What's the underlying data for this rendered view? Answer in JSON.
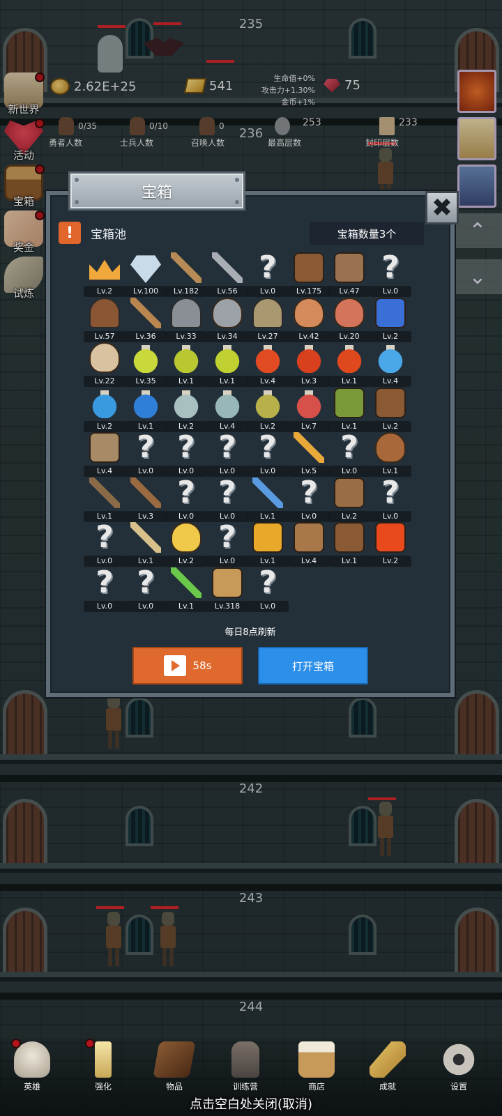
{
  "floors": [
    "235",
    "236",
    "242",
    "243",
    "244"
  ],
  "hud": {
    "gold": "2.62E+25",
    "bars": "541",
    "gems": "75",
    "bonus_hp": "生命值+0%",
    "bonus_atk": "攻击力+1.30%",
    "bonus_gold": "金币+1%"
  },
  "stats": [
    {
      "value": "0/35",
      "label": "勇者人数"
    },
    {
      "value": "0/10",
      "label": "士兵人数"
    },
    {
      "value": "0",
      "label": "召唤人数"
    },
    {
      "value": "253",
      "label": "最高层数"
    },
    {
      "value": "233",
      "label": "封印层数"
    }
  ],
  "side_menu": [
    {
      "label": "新世界",
      "icon": "scroll-map-icon"
    },
    {
      "label": "活动",
      "icon": "heart-icon"
    },
    {
      "label": "宝箱",
      "icon": "treasure-chest-icon"
    },
    {
      "label": "奖金",
      "icon": "envelope-icon"
    },
    {
      "label": "试炼",
      "icon": "feather-icon"
    }
  ],
  "modal": {
    "title": "宝箱",
    "pool_label": "宝箱池",
    "chest_count": "宝箱数量3个",
    "refresh_note": "每日8点刷新",
    "video_button": "58s",
    "open_button": "打开宝箱",
    "close_glyph": "✖",
    "alert_glyph": "!"
  },
  "items": [
    {
      "name": "crown-icon",
      "lv": "Lv.2",
      "color": "#f0a83a"
    },
    {
      "name": "diamond-icon",
      "lv": "Lv.100",
      "color": "#c9dbe8"
    },
    {
      "name": "bronze-sword-icon",
      "lv": "Lv.182",
      "color": "#b88a55"
    },
    {
      "name": "iron-sword-icon",
      "lv": "Lv.56",
      "color": "#a9aeb4"
    },
    {
      "name": "unknown-icon",
      "lv": "Lv.0",
      "color": ""
    },
    {
      "name": "leather-armor-icon",
      "lv": "Lv.175",
      "color": "#8a5a34"
    },
    {
      "name": "backpack-icon",
      "lv": "Lv.47",
      "color": "#9a7250"
    },
    {
      "name": "unknown-icon",
      "lv": "Lv.0",
      "color": ""
    },
    {
      "name": "leather-helmet-icon",
      "lv": "Lv.57",
      "color": "#8a5634"
    },
    {
      "name": "dagger-icon",
      "lv": "Lv.36",
      "color": "#b8864e"
    },
    {
      "name": "knight-helmet-icon",
      "lv": "Lv.33",
      "color": "#8a8f96"
    },
    {
      "name": "hammer-icon",
      "lv": "Lv.34",
      "color": "#9ca2a8"
    },
    {
      "name": "great-helm-icon",
      "lv": "Lv.27",
      "color": "#a99870"
    },
    {
      "name": "ham-icon",
      "lv": "Lv.42",
      "color": "#d48a5a"
    },
    {
      "name": "steak-icon",
      "lv": "Lv.20",
      "color": "#d4745a"
    },
    {
      "name": "blue-pouch-icon",
      "lv": "Lv.2",
      "color": "#3a6fd8"
    },
    {
      "name": "bread-icon",
      "lv": "Lv.22",
      "color": "#d9c2a0"
    },
    {
      "name": "yellow-potion-icon",
      "lv": "Lv.35",
      "color": "#c9d83a"
    },
    {
      "name": "yellow-potion-icon",
      "lv": "Lv.1",
      "color": "#b9c830"
    },
    {
      "name": "yellow-potion-icon",
      "lv": "Lv.1",
      "color": "#bfd030"
    },
    {
      "name": "red-potion-icon",
      "lv": "Lv.4",
      "color": "#e24a22"
    },
    {
      "name": "red-potion-icon",
      "lv": "Lv.3",
      "color": "#d8401e"
    },
    {
      "name": "red-potion-icon",
      "lv": "Lv.1",
      "color": "#e0481e"
    },
    {
      "name": "blue-potion-icon",
      "lv": "Lv.4",
      "color": "#4aa8e8"
    },
    {
      "name": "blue-potion-icon",
      "lv": "Lv.2",
      "color": "#3a9ae0"
    },
    {
      "name": "blue-potion-icon",
      "lv": "Lv.1",
      "color": "#2f7ed8"
    },
    {
      "name": "empty-flask-icon",
      "lv": "Lv.2",
      "color": "#a8c0c0"
    },
    {
      "name": "empty-flask-icon",
      "lv": "Lv.4",
      "color": "#98b8b8"
    },
    {
      "name": "wine-bottle-icon",
      "lv": "Lv.2",
      "color": "#b8b04a"
    },
    {
      "name": "red-vial-icon",
      "lv": "Lv.7",
      "color": "#d8504a"
    },
    {
      "name": "winged-boot-icon",
      "lv": "Lv.1",
      "color": "#7a9a3a"
    },
    {
      "name": "leather-boot-icon",
      "lv": "Lv.2",
      "color": "#8a5a34"
    },
    {
      "name": "cloth-boot-icon",
      "lv": "Lv.4",
      "color": "#a88a66"
    },
    {
      "name": "unknown-icon",
      "lv": "Lv.0",
      "color": ""
    },
    {
      "name": "unknown-icon",
      "lv": "Lv.0",
      "color": ""
    },
    {
      "name": "unknown-icon",
      "lv": "Lv.0",
      "color": ""
    },
    {
      "name": "unknown-icon",
      "lv": "Lv.0",
      "color": ""
    },
    {
      "name": "torch-icon",
      "lv": "Lv.5",
      "color": "#e8a83a"
    },
    {
      "name": "unknown-icon",
      "lv": "Lv.0",
      "color": ""
    },
    {
      "name": "mushroom-icon",
      "lv": "Lv.1",
      "color": "#a8683a"
    },
    {
      "name": "pickaxe-icon",
      "lv": "Lv.1",
      "color": "#8a6a48"
    },
    {
      "name": "wooden-staff-icon",
      "lv": "Lv.3",
      "color": "#9a6a40"
    },
    {
      "name": "unknown-icon",
      "lv": "Lv.0",
      "color": ""
    },
    {
      "name": "unknown-icon",
      "lv": "Lv.0",
      "color": ""
    },
    {
      "name": "blue-scepter-icon",
      "lv": "Lv.1",
      "color": "#5a9ae0"
    },
    {
      "name": "unknown-icon",
      "lv": "Lv.0",
      "color": ""
    },
    {
      "name": "travel-bag-icon",
      "lv": "Lv.2",
      "color": "#9a6e44"
    },
    {
      "name": "unknown-icon",
      "lv": "Lv.0",
      "color": ""
    },
    {
      "name": "unknown-icon",
      "lv": "Lv.0",
      "color": ""
    },
    {
      "name": "bone-club-icon",
      "lv": "Lv.1",
      "color": "#d8c08a"
    },
    {
      "name": "cheese-icon",
      "lv": "Lv.2",
      "color": "#f0c84a"
    },
    {
      "name": "unknown-icon",
      "lv": "Lv.0",
      "color": ""
    },
    {
      "name": "honey-jar-icon",
      "lv": "Lv.1",
      "color": "#e8a82a"
    },
    {
      "name": "bow-icon",
      "lv": "Lv.4",
      "color": "#a8784a"
    },
    {
      "name": "quiver-icon",
      "lv": "Lv.1",
      "color": "#8a5a34"
    },
    {
      "name": "fire-shield-icon",
      "lv": "Lv.2",
      "color": "#e84a1e"
    },
    {
      "name": "unknown-icon",
      "lv": "Lv.0",
      "color": ""
    },
    {
      "name": "unknown-icon",
      "lv": "Lv.0",
      "color": ""
    },
    {
      "name": "green-wand-icon",
      "lv": "Lv.1",
      "color": "#6ac84a"
    },
    {
      "name": "ale-mug-icon",
      "lv": "Lv.318",
      "color": "#c89a5a"
    },
    {
      "name": "unknown-icon",
      "lv": "Lv.0",
      "color": ""
    }
  ],
  "bottom_nav": [
    {
      "label": "英雄",
      "icon": "skull-icon"
    },
    {
      "label": "强化",
      "icon": "candle-icon"
    },
    {
      "label": "物品",
      "icon": "book-icon"
    },
    {
      "label": "训练营",
      "icon": "lantern-icon"
    },
    {
      "label": "商店",
      "icon": "beer-mug-icon"
    },
    {
      "label": "成就",
      "icon": "key-icon"
    },
    {
      "label": "设置",
      "icon": "gear-icon"
    }
  ],
  "close_hint": "点击空白处关闭(取消)"
}
